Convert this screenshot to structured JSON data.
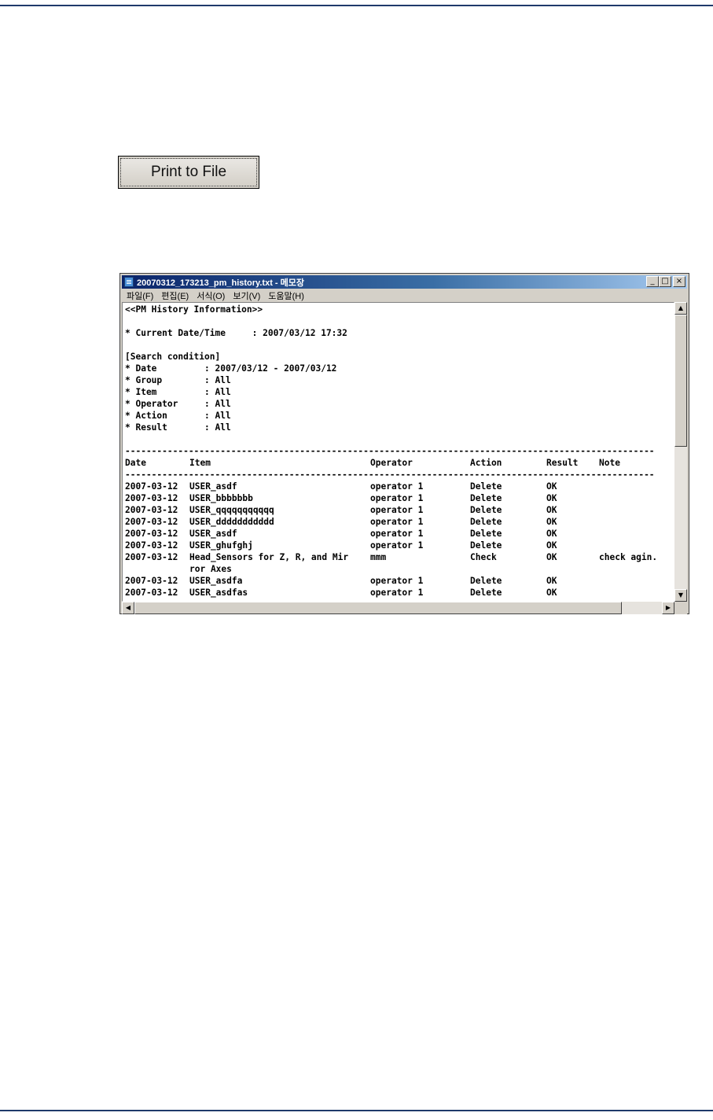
{
  "button": {
    "label": "Print to File"
  },
  "window": {
    "title": "20070312_173213_pm_history.txt - 메모장",
    "controls": {
      "minimize": "_",
      "maximize": "□",
      "close": "×"
    },
    "menu": [
      "파일(F)",
      "편집(E)",
      "서식(O)",
      "보기(V)",
      "도움말(H)"
    ]
  },
  "document": {
    "header_lines": [
      "<<PM History Information>>",
      "",
      "* Current Date/Time     : 2007/03/12 17:32",
      "",
      "[Search condition]",
      "* Date         : 2007/03/12 - 2007/03/12",
      "* Group        : All",
      "* Item         : All",
      "* Operator     : All",
      "* Action       : All",
      "* Result       : All",
      ""
    ],
    "separator": "----------------------------------------------------------------------------------------------------",
    "columns": [
      "Date",
      "Item",
      "Operator",
      "Action",
      "Result",
      "Note"
    ],
    "rows": [
      [
        "2007-03-12",
        "USER_asdf",
        "operator 1",
        "Delete",
        "OK",
        ""
      ],
      [
        "2007-03-12",
        "USER_bbbbbbb",
        "operator 1",
        "Delete",
        "OK",
        ""
      ],
      [
        "2007-03-12",
        "USER_qqqqqqqqqqq",
        "operator 1",
        "Delete",
        "OK",
        ""
      ],
      [
        "2007-03-12",
        "USER_ddddddddddd",
        "operator 1",
        "Delete",
        "OK",
        ""
      ],
      [
        "2007-03-12",
        "USER_asdf",
        "operator 1",
        "Delete",
        "OK",
        ""
      ],
      [
        "2007-03-12",
        "USER_ghufghj",
        "operator 1",
        "Delete",
        "OK",
        ""
      ],
      [
        "2007-03-12",
        "Head_Sensors for Z, R, and Mir",
        "mmm",
        "Check",
        "OK",
        "check agin."
      ],
      [
        "",
        "ror Axes",
        "",
        "",
        "",
        ""
      ],
      [
        "2007-03-12",
        "USER_asdfa",
        "operator 1",
        "Delete",
        "OK",
        ""
      ],
      [
        "2007-03-12",
        "USER_asdfas",
        "operator 1",
        "Delete",
        "OK",
        ""
      ]
    ]
  }
}
